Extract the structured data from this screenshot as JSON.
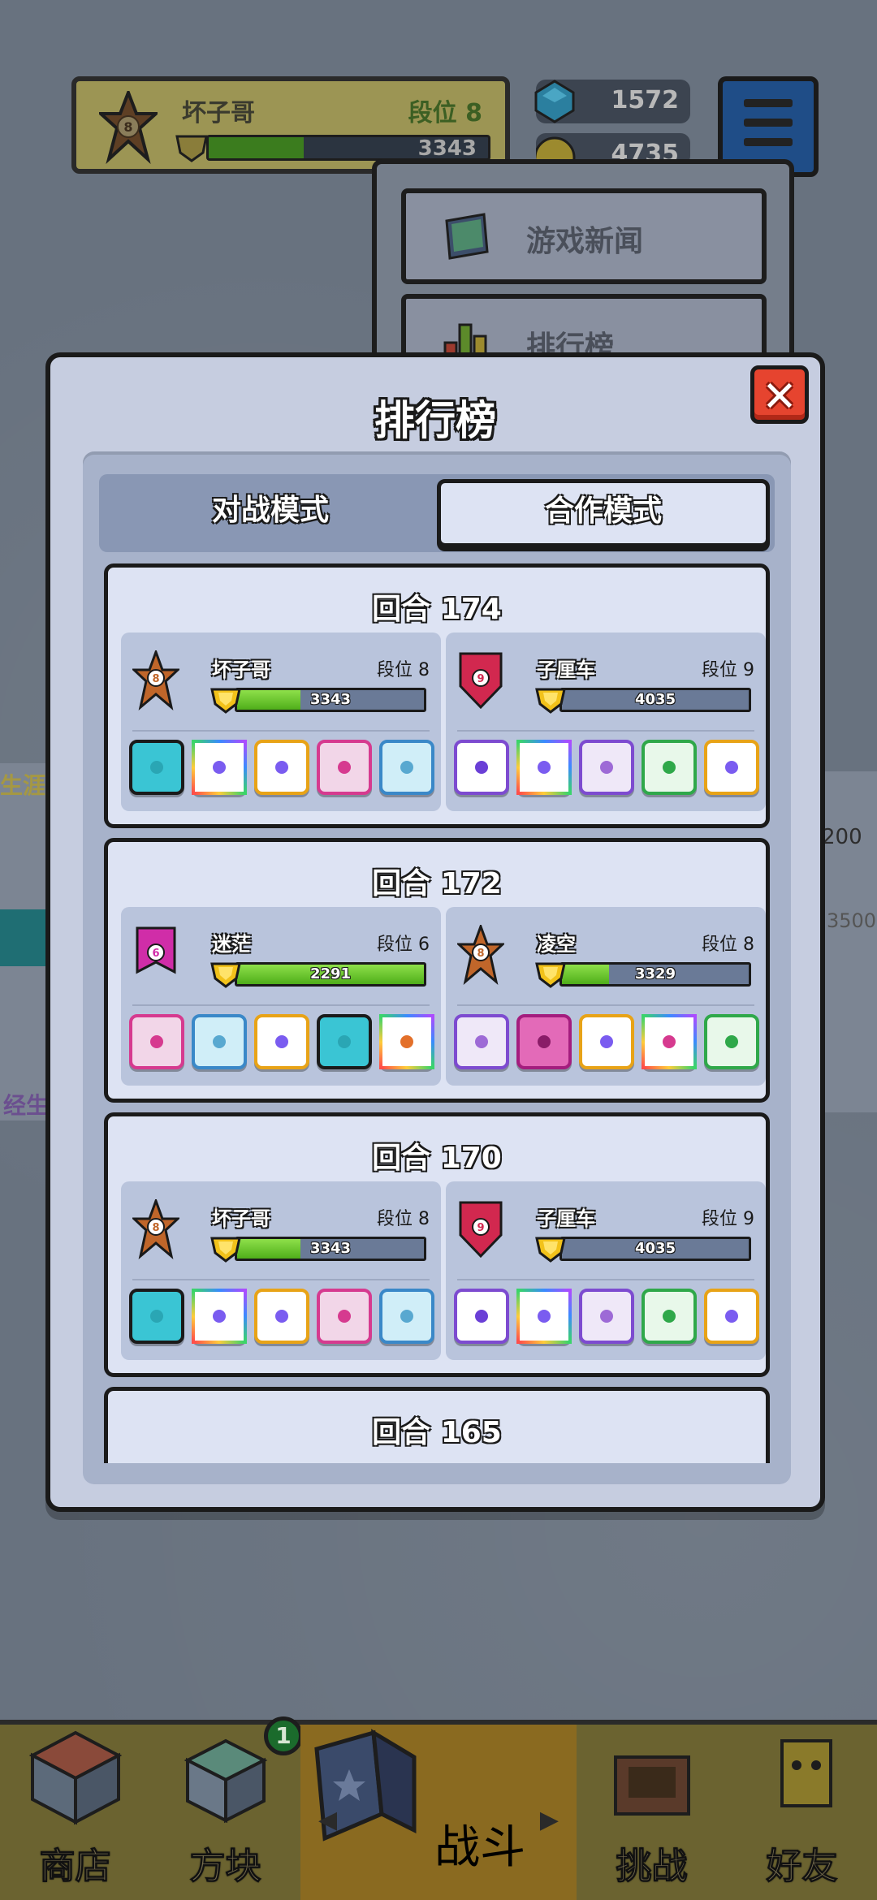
{
  "background": {
    "profile": {
      "name": "坏子哥",
      "rank_label": "段位 8",
      "rank_number": "8",
      "trophies": "3343",
      "progress": 0.34
    },
    "currencies": [
      {
        "icon": "gem-icon",
        "value": "1572"
      },
      {
        "icon": "gold-coin-icon",
        "value": "4735"
      }
    ],
    "dropdown": {
      "items": [
        {
          "label": "游戏新闻",
          "icon": "news-monitor-icon"
        },
        {
          "label": "排行榜",
          "icon": "leaderboard-chart-icon"
        }
      ]
    },
    "side_left": {
      "text_top": "生涯",
      "text_bottom": "经生"
    },
    "side_right": {
      "text_top": "200",
      "text_mid": "3500"
    }
  },
  "modal": {
    "title": "排行榜",
    "close_label": "✕",
    "tabs": [
      {
        "label": "对战模式",
        "active": false
      },
      {
        "label": "合作模式",
        "active": true
      }
    ],
    "rounds": [
      {
        "title": "回合 174",
        "players": [
          {
            "name": "坏子哥",
            "level": "段位 8",
            "rank_number": "8",
            "rank_shape": "star",
            "rank_color": "#c0662a",
            "trophies": "3343",
            "progress": 0.34,
            "dice": [
              {
                "color": "#3ac5d4",
                "pip": "#2aa6b4"
              },
              {
                "color": "#ffffff",
                "pip": "#7a5cf0",
                "frame": "rainbow"
              },
              {
                "color": "#ffffff",
                "pip": "#7a5cf0",
                "frame": "gold"
              },
              {
                "color": "#f2d6e8",
                "pip": "#d63a8f",
                "frame": "pink"
              },
              {
                "color": "#d0eef8",
                "pip": "#58a8d0",
                "frame": "blue"
              }
            ]
          },
          {
            "name": "子厘车",
            "level": "段位 9",
            "rank_number": "9",
            "rank_shape": "shield",
            "rank_color": "#d2284f",
            "trophies": "4035",
            "progress": 0.0,
            "dice": [
              {
                "color": "#ffffff",
                "pip": "#6a3fd6",
                "frame": "purple"
              },
              {
                "color": "#ffffff",
                "pip": "#7a5cf0",
                "frame": "rainbow"
              },
              {
                "color": "#efe8f8",
                "pip": "#9d6ad6",
                "frame": "purple"
              },
              {
                "color": "#e8f8ea",
                "pip": "#2fa84a",
                "frame": "green"
              },
              {
                "color": "#ffffff",
                "pip": "#7a5cf0",
                "frame": "gold"
              }
            ]
          }
        ]
      },
      {
        "title": "回合 172",
        "players": [
          {
            "name": "迷茫",
            "level": "段位 6",
            "rank_number": "6",
            "rank_shape": "ribbon",
            "rank_color": "#d02da8",
            "trophies": "2291",
            "progress": 1.0,
            "dice": [
              {
                "color": "#f2d6e8",
                "pip": "#d63a8f",
                "frame": "pink"
              },
              {
                "color": "#d0eef8",
                "pip": "#58a8d0",
                "frame": "blue"
              },
              {
                "color": "#ffffff",
                "pip": "#7a5cf0",
                "frame": "gold"
              },
              {
                "color": "#3ac5d4",
                "pip": "#2aa6b4"
              },
              {
                "color": "#ffffff",
                "pip": "#e3702a",
                "frame": "rainbow"
              }
            ]
          },
          {
            "name": "凌空",
            "level": "段位 8",
            "rank_number": "8",
            "rank_shape": "star",
            "rank_color": "#c0662a",
            "trophies": "3329",
            "progress": 0.25,
            "dice": [
              {
                "color": "#efe8f8",
                "pip": "#9d6ad6",
                "frame": "purple"
              },
              {
                "color": "#e36ab8",
                "pip": "#8a1c68",
                "frame": "magenta"
              },
              {
                "color": "#ffffff",
                "pip": "#7a5cf0",
                "frame": "gold"
              },
              {
                "color": "#ffffff",
                "pip": "#d63a8f",
                "frame": "rainbow"
              },
              {
                "color": "#e8f8ea",
                "pip": "#2fa84a",
                "frame": "green"
              }
            ]
          }
        ]
      },
      {
        "title": "回合 170",
        "players": [
          {
            "name": "坏子哥",
            "level": "段位 8",
            "rank_number": "8",
            "rank_shape": "star",
            "rank_color": "#c0662a",
            "trophies": "3343",
            "progress": 0.34,
            "dice": [
              {
                "color": "#3ac5d4",
                "pip": "#2aa6b4"
              },
              {
                "color": "#ffffff",
                "pip": "#7a5cf0",
                "frame": "rainbow"
              },
              {
                "color": "#ffffff",
                "pip": "#7a5cf0",
                "frame": "gold"
              },
              {
                "color": "#f2d6e8",
                "pip": "#d63a8f",
                "frame": "pink"
              },
              {
                "color": "#d0eef8",
                "pip": "#58a8d0",
                "frame": "blue"
              }
            ]
          },
          {
            "name": "子厘车",
            "level": "段位 9",
            "rank_number": "9",
            "rank_shape": "shield",
            "rank_color": "#d2284f",
            "trophies": "4035",
            "progress": 0.0,
            "dice": [
              {
                "color": "#ffffff",
                "pip": "#6a3fd6",
                "frame": "purple"
              },
              {
                "color": "#ffffff",
                "pip": "#7a5cf0",
                "frame": "rainbow"
              },
              {
                "color": "#efe8f8",
                "pip": "#9d6ad6",
                "frame": "purple"
              },
              {
                "color": "#e8f8ea",
                "pip": "#2fa84a",
                "frame": "green"
              },
              {
                "color": "#ffffff",
                "pip": "#7a5cf0",
                "frame": "gold"
              }
            ]
          }
        ]
      },
      {
        "title": "回合 165",
        "players": []
      }
    ]
  },
  "bottom_nav": {
    "items": [
      {
        "label": "商店",
        "icon": "shop-icon"
      },
      {
        "label": "方块",
        "icon": "dice-box-icon",
        "badge": "1"
      },
      {
        "label": "战斗",
        "icon": "battle-shield-icon",
        "active": true
      },
      {
        "label": "挑战",
        "icon": "challenge-gate-icon"
      },
      {
        "label": "好友",
        "icon": "friend-icon"
      }
    ]
  },
  "colors": {
    "frame_rainbow": "#ff5a5a",
    "frame_gold": "#e8a317",
    "frame_pink": "#d63a8f",
    "frame_blue": "#3a88c8",
    "frame_purple": "#7d4bd0",
    "frame_green": "#2fa84a",
    "frame_magenta": "#a41d7e"
  }
}
